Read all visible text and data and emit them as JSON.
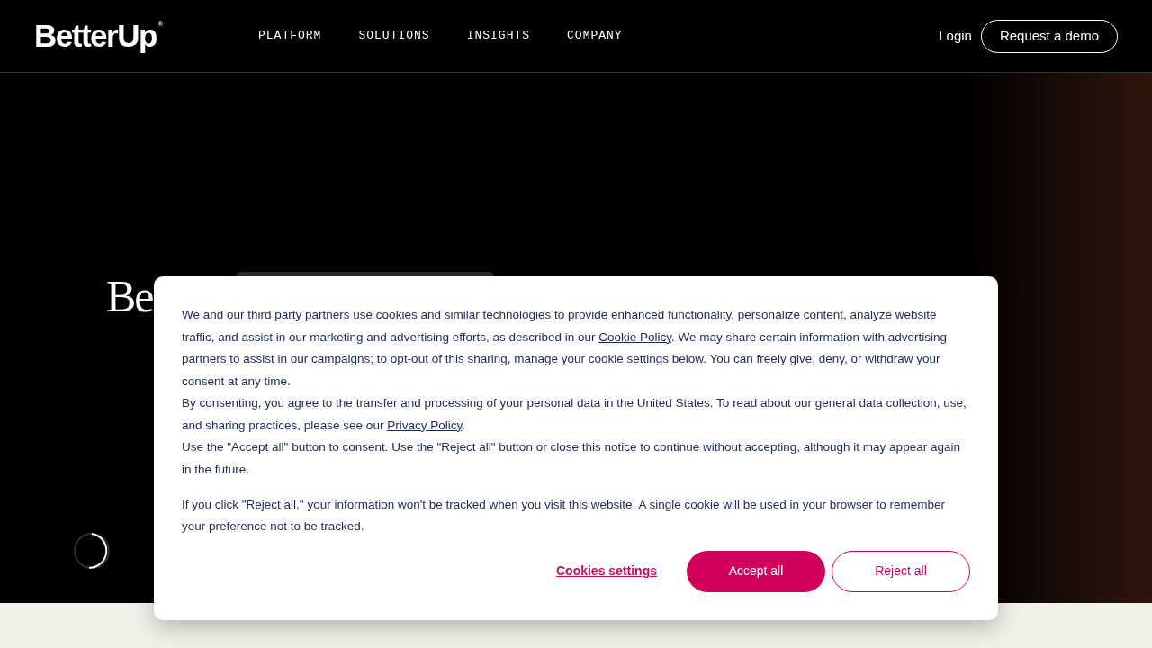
{
  "header": {
    "logo": {
      "text": "BetterUp",
      "mark": "®"
    },
    "nav": [
      {
        "label": "PLATFORM"
      },
      {
        "label": "SOLUTIONS"
      },
      {
        "label": "INSIGHTS"
      },
      {
        "label": "COMPANY"
      }
    ],
    "login": "Login",
    "cta": "Request a demo"
  },
  "hero": {
    "heading": "Be"
  },
  "cookie_banner": {
    "paragraphs": [
      {
        "segments": [
          {
            "kind": "text",
            "text": "We and our third party partners use cookies and similar technologies to provide enhanced functionality, personalize content, analyze website traffic, and assist in our marketing and advertising efforts, as described in our "
          },
          {
            "kind": "link",
            "text": "Cookie Policy"
          },
          {
            "kind": "text",
            "text": ". We may share certain information with advertising partners to assist in our campaigns; to opt-out of this sharing, manage your cookie settings below. You can freely give, deny, or withdraw your consent at any time."
          }
        ]
      },
      {
        "segments": [
          {
            "kind": "text",
            "text": "By consenting, you agree to the transfer and processing of your personal data in the United States. To read about our general data collection, use, and sharing practices, please see our "
          },
          {
            "kind": "link",
            "text": "Privacy Policy"
          },
          {
            "kind": "text",
            "text": "."
          }
        ]
      },
      {
        "segments": [
          {
            "kind": "text",
            "text": "Use the \"Accept all\" button to consent. Use the \"Reject all\" button or close this notice to continue without accepting, although it may appear again in the future."
          }
        ]
      }
    ],
    "note": "If you click \"Reject all,\" your information won't be tracked when you visit this website. A single cookie will be used in your browser to remember your preference not to be tracked.",
    "buttons": [
      {
        "kind": "link",
        "label": "Cookies settings"
      },
      {
        "kind": "primary",
        "label": "Accept all"
      },
      {
        "kind": "outline",
        "label": "Reject all"
      }
    ]
  }
}
